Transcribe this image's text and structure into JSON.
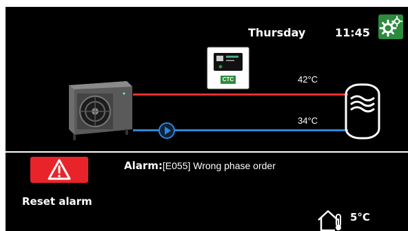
{
  "header": {
    "day": "Thursday",
    "time": "11:45"
  },
  "system": {
    "supply_temp": "42°C",
    "return_temp": "34°C",
    "controller_brand": "CTC"
  },
  "alarm": {
    "reset_label": "Reset alarm",
    "title": "Alarm:",
    "message": "[E055] Wrong phase order"
  },
  "outdoor": {
    "temperature": "5°C"
  },
  "icons": {
    "settings": "gears-icon",
    "alarm": "warning-triangle-icon",
    "pump": "circulation-pump-icon",
    "outdoor": "house-thermometer-icon"
  },
  "colors": {
    "hot_pipe": "#e53232",
    "cold_pipe": "#2f86d8",
    "alarm_red": "#e8242a",
    "settings_green": "#2e8b3e"
  }
}
